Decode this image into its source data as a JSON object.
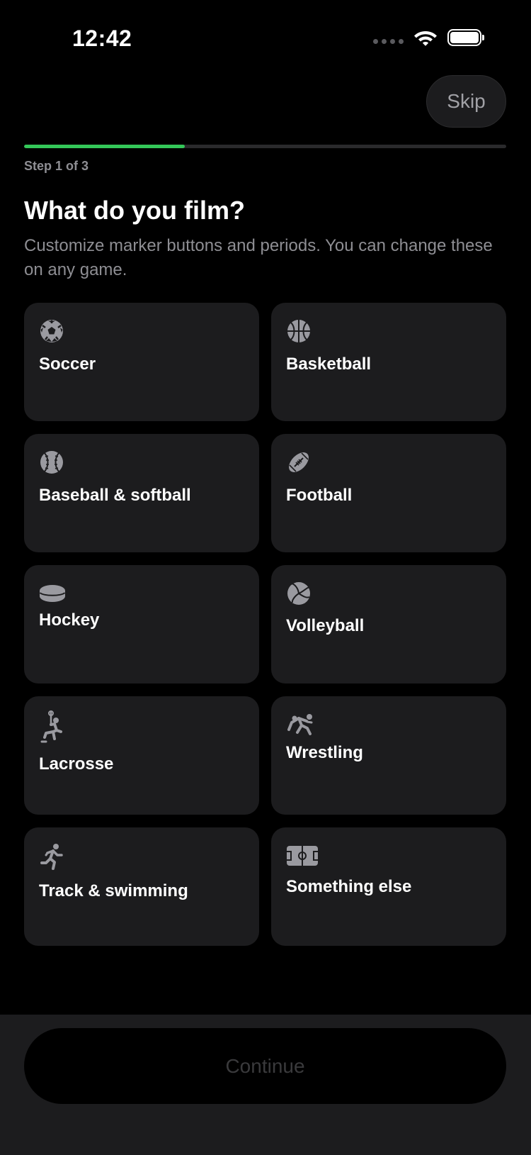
{
  "status_bar": {
    "time": "12:42"
  },
  "header": {
    "skip_label": "Skip",
    "step_label": "Step 1 of 3",
    "progress_fraction": 0.333
  },
  "main": {
    "title": "What do you film?",
    "subtitle": "Customize marker buttons and periods. You can change these on any game.",
    "sports": [
      {
        "label": "Soccer",
        "icon": "soccer-ball-icon"
      },
      {
        "label": "Basketball",
        "icon": "basketball-icon"
      },
      {
        "label": "Baseball & softball",
        "icon": "baseball-icon"
      },
      {
        "label": "Football",
        "icon": "football-icon"
      },
      {
        "label": "Hockey",
        "icon": "hockey-puck-icon"
      },
      {
        "label": "Volleyball",
        "icon": "volleyball-icon"
      },
      {
        "label": "Lacrosse",
        "icon": "lacrosse-player-icon"
      },
      {
        "label": "Wrestling",
        "icon": "wrestling-icon"
      },
      {
        "label": "Track & swimming",
        "icon": "runner-icon"
      },
      {
        "label": "Something else",
        "icon": "field-icon"
      }
    ]
  },
  "footer": {
    "continue_label": "Continue"
  },
  "colors": {
    "accent": "#34c759",
    "card_background": "#1c1c1e",
    "secondary_text": "#8e8e93"
  }
}
